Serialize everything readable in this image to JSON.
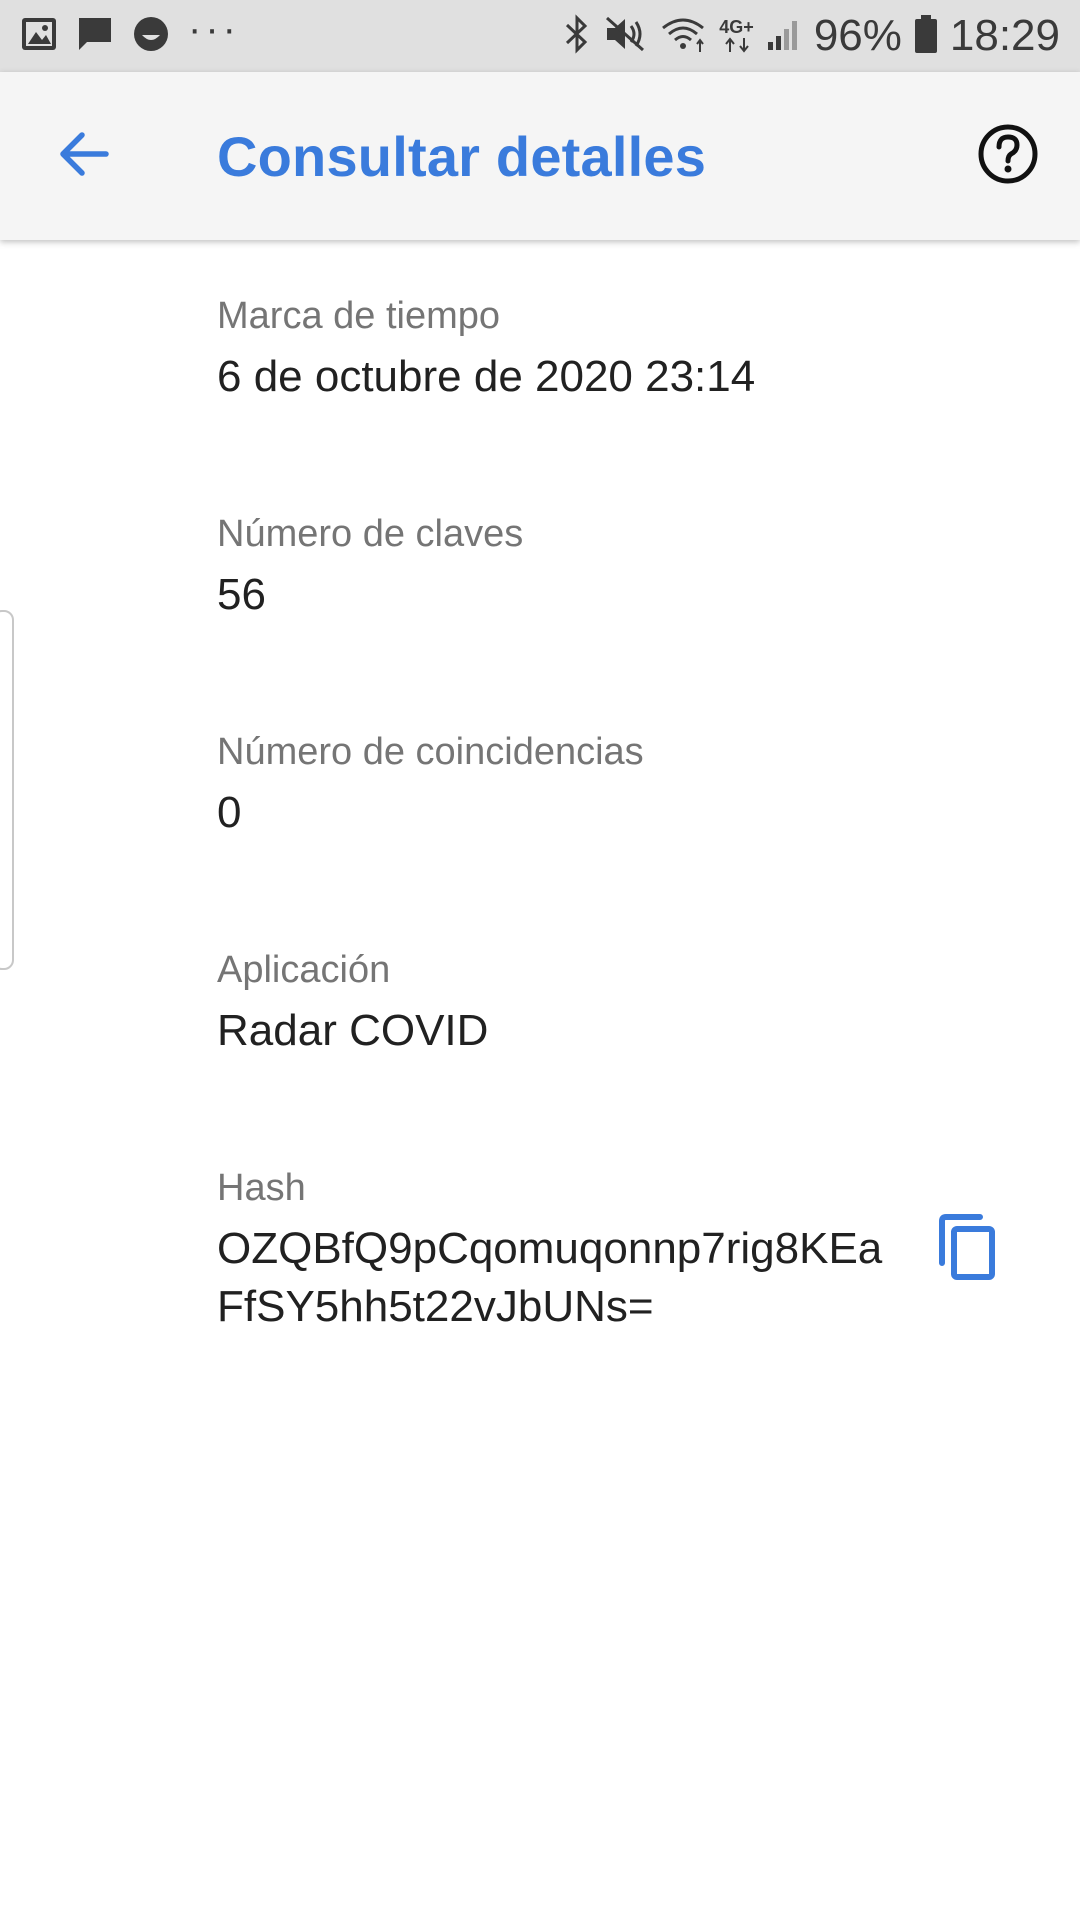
{
  "status_bar": {
    "battery_percent": "96%",
    "time": "18:29",
    "network_label": "4G+",
    "left_icons": [
      "image-icon",
      "message-icon",
      "emoji-icon",
      "more-dots-icon"
    ],
    "right_icons": [
      "bluetooth-icon",
      "mute-icon",
      "wifi-icon",
      "mobile-data-icon",
      "signal-icon",
      "battery-icon"
    ]
  },
  "app_bar": {
    "title": "Consultar detalles",
    "back_icon": "arrow-back-icon",
    "help_icon": "help-circle-icon",
    "accent_color": "#3a7bdc"
  },
  "details": [
    {
      "label": "Marca de tiempo",
      "value": "6 de octubre de 2020 23:14"
    },
    {
      "label": "Número de claves",
      "value": "56"
    },
    {
      "label": "Número de coincidencias",
      "value": "0"
    },
    {
      "label": "Aplicación",
      "value": "Radar COVID"
    },
    {
      "label": "Hash",
      "value": "OZQBfQ9pCqomuqonnp7rig8KEaFfSY5hh5t22vJbUNs="
    }
  ],
  "copy_icon": "copy-icon"
}
